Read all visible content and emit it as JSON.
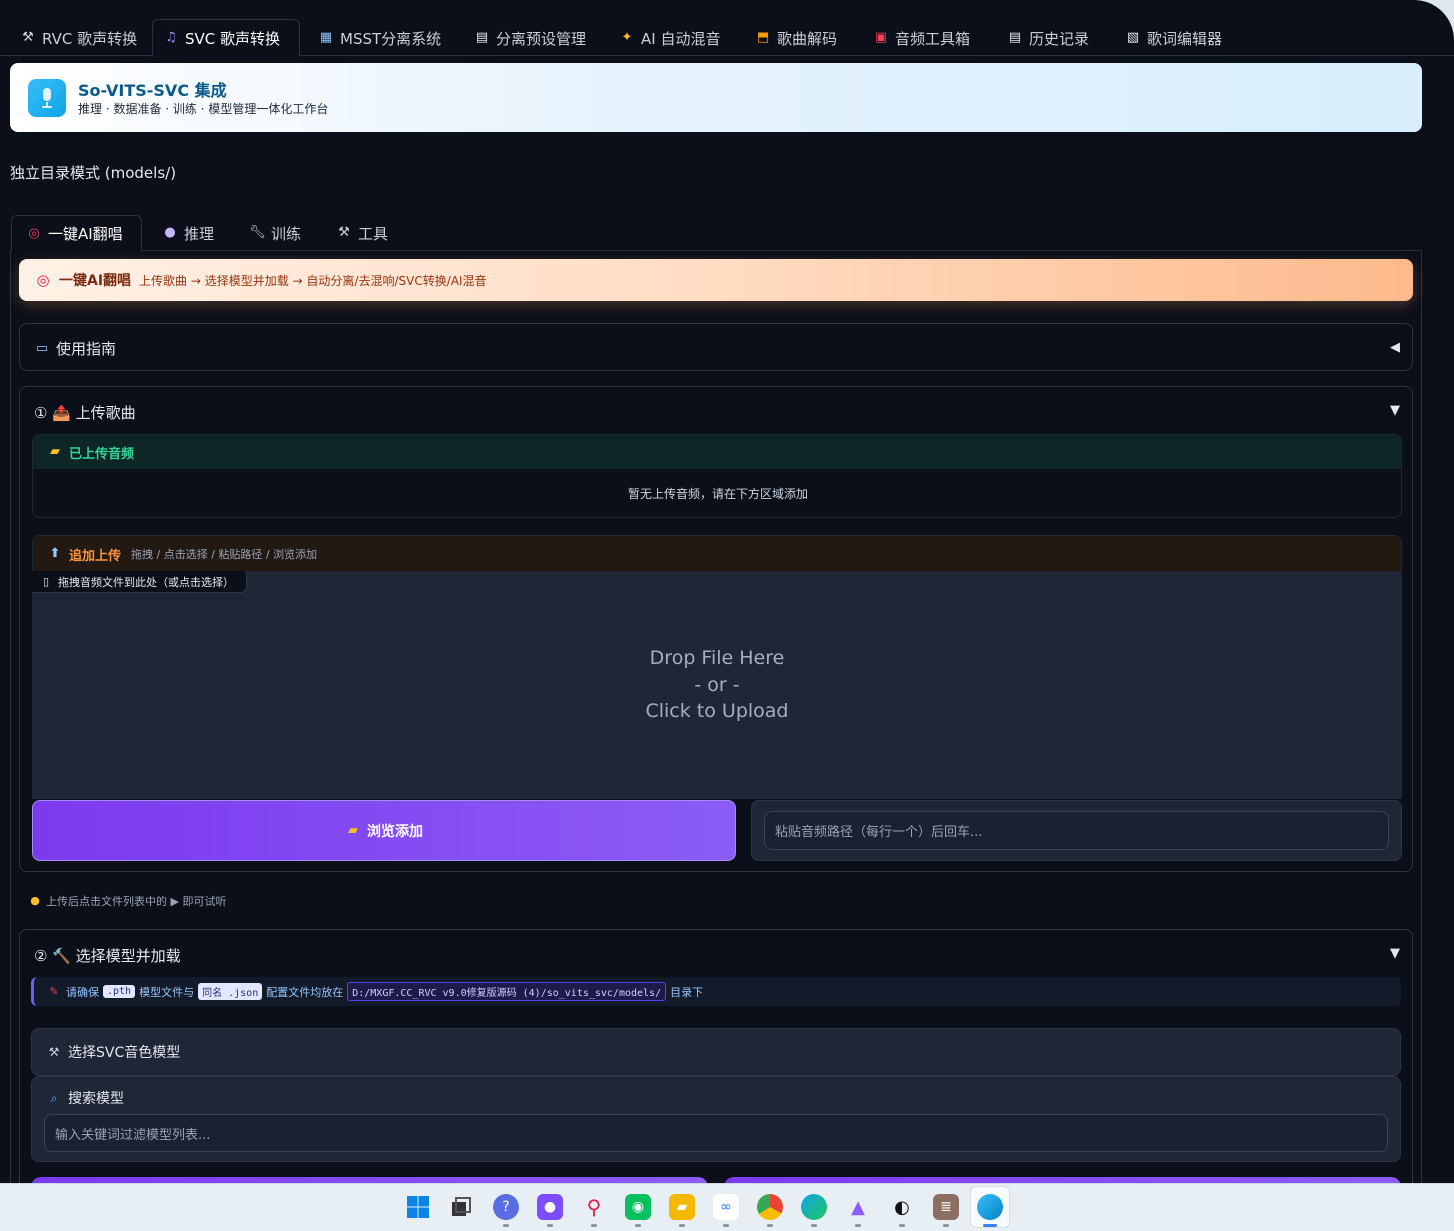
{
  "top_tabs": [
    {
      "label": "RVC 歌声转换",
      "icon": "wand-icon"
    },
    {
      "label": "SVC 歌声转换",
      "icon": "music-note-icon",
      "active": true
    },
    {
      "label": "MSST分离系统",
      "icon": "grid-icon"
    },
    {
      "label": "分离预设管理",
      "icon": "clipboard-icon"
    },
    {
      "label": "AI 自动混音",
      "icon": "sparkle-icon"
    },
    {
      "label": "歌曲解码",
      "icon": "unlock-icon"
    },
    {
      "label": "音频工具箱",
      "icon": "toolbox-icon"
    },
    {
      "label": "历史记录",
      "icon": "document-icon"
    },
    {
      "label": "歌词编辑器",
      "icon": "lyrics-icon"
    }
  ],
  "banner": {
    "title": "So-VITS-SVC 集成",
    "subtitle": "推理 · 数据准备 · 训练 · 模型管理一体化工作台"
  },
  "mode_text": "独立目录模式 (models/)",
  "sub_tabs": [
    {
      "label": "一键AI翻唱",
      "icon": "target-icon",
      "active": true
    },
    {
      "label": "推理",
      "icon": "crystal-ball-icon"
    },
    {
      "label": "训练",
      "icon": "wrench-icon"
    },
    {
      "label": "工具",
      "icon": "tools-icon"
    }
  ],
  "orange_banner": {
    "title": "一键AI翻唱",
    "subtitle": "上传歌曲 → 选择模型并加载 → 自动分离/去混响/SVC转换/AI混音"
  },
  "guide": {
    "label": "使用指南"
  },
  "upload_section": {
    "title": "① 📤 上传歌曲",
    "uploaded_header": "已上传音频",
    "uploaded_empty": "暂无上传音频，请在下方区域添加",
    "add_header": "追加上传",
    "add_hint": "拖拽 / 点击选择 / 粘贴路径 / 浏览添加",
    "drop_label": "拖拽音频文件到此处（或点击选择）",
    "drop_line1": "Drop File Here",
    "drop_line2": "- or -",
    "drop_line3": "Click to Upload",
    "browse_label": "浏览添加",
    "path_placeholder": "粘贴音频路径（每行一个）后回车..."
  },
  "hint_text": "上传后点击文件列表中的 ▶ 即可试听",
  "model_section": {
    "title": "② 🔨 选择模型并加载",
    "notice_pre": "请确保",
    "notice_code1": ".pth",
    "notice_mid1": "模型文件与",
    "notice_code2": "同名 .json",
    "notice_mid2": "配置文件均放在",
    "notice_code3": "D:/MXGF.CC_RVC v9.0修复版源码 (4)/so_vits_svc/models/",
    "notice_post": "目录下",
    "select_label": "选择SVC音色模型",
    "search_label": "搜索模型",
    "search_placeholder": "输入关键词过滤模型列表..."
  },
  "taskbar_icons": [
    "windows-start-icon",
    "task-view-icon",
    "copilot-icon",
    "app-icon",
    "search-app-icon",
    "wechat-icon",
    "file-explorer-icon",
    "baidu-netdisk-icon",
    "chrome-icon",
    "edge-icon",
    "app-icon-2",
    "qq-icon",
    "app-icon-3",
    "active-app-icon"
  ],
  "colors": {
    "accent": "#7c3aed",
    "bg": "#0b0f19",
    "banner_text": "#0b5a8a"
  }
}
